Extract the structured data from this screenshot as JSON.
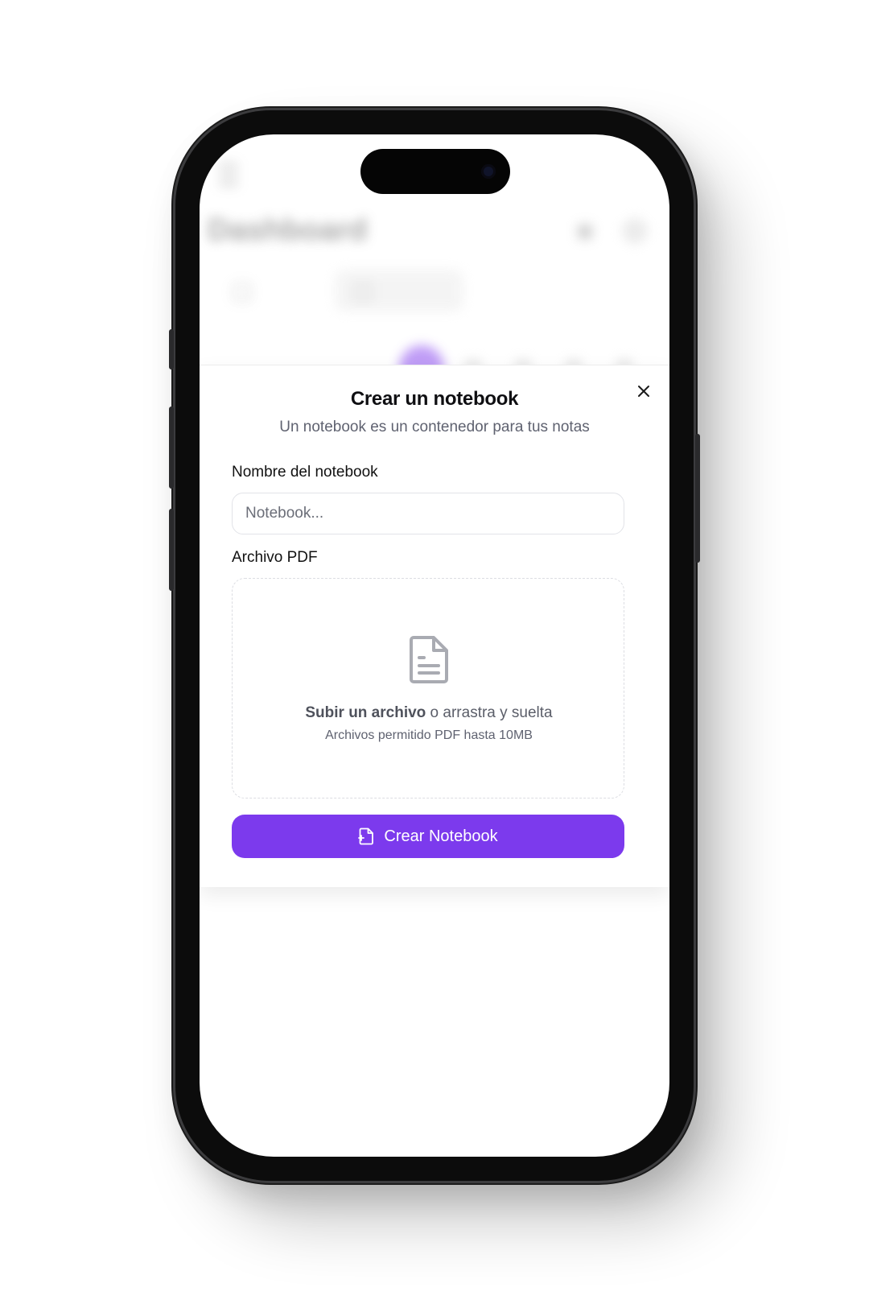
{
  "background": {
    "title": "Dashboard"
  },
  "modal": {
    "title": "Crear un notebook",
    "subtitle": "Un notebook es un contenedor para tus notas",
    "name_label": "Nombre del notebook",
    "name_placeholder": "Notebook...",
    "name_value": "",
    "pdf_label": "Archivo PDF",
    "upload_link": "Subir un archivo",
    "upload_rest": " o arrastra y suelta",
    "upload_hint": "Archivos permitido PDF hasta 10MB",
    "submit_label": "Crear Notebook"
  },
  "colors": {
    "accent": "#7c3aed",
    "accent_text": "#ffffff"
  },
  "icons": {
    "close": "close-icon",
    "document": "document-icon",
    "submit": "file-plus-icon"
  }
}
